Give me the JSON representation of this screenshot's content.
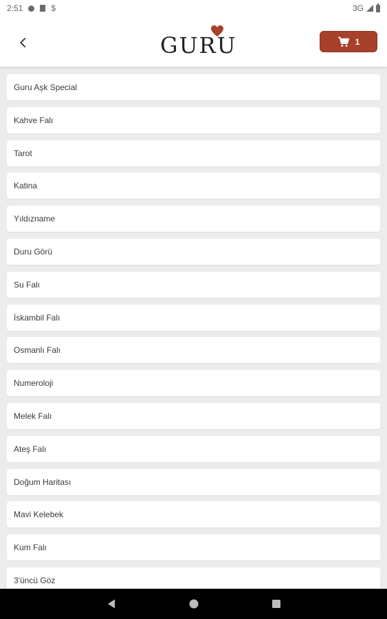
{
  "status_bar": {
    "time": "2:51",
    "network": "3G"
  },
  "app_bar": {
    "logo_text": "GURU",
    "cart_count": "1",
    "accent_color": "#a8412c"
  },
  "list": {
    "items": [
      {
        "label": "Guru Aşk Special"
      },
      {
        "label": "Kahve Falı"
      },
      {
        "label": "Tarot"
      },
      {
        "label": "Katina"
      },
      {
        "label": "Yıldızname"
      },
      {
        "label": "Duru Görü"
      },
      {
        "label": "Su Falı"
      },
      {
        "label": "İskambil Falı"
      },
      {
        "label": "Osmanlı Falı"
      },
      {
        "label": "Numeroloji"
      },
      {
        "label": "Melek Falı"
      },
      {
        "label": "Ateş Falı"
      },
      {
        "label": "Doğum Haritası"
      },
      {
        "label": "Mavi Kelebek"
      },
      {
        "label": "Kum Falı"
      },
      {
        "label": "3'üncü Göz"
      }
    ]
  },
  "icons": {
    "back": "chevron-left-icon",
    "cart": "shopping-cart-icon",
    "logo_heart": "heart-icon"
  }
}
